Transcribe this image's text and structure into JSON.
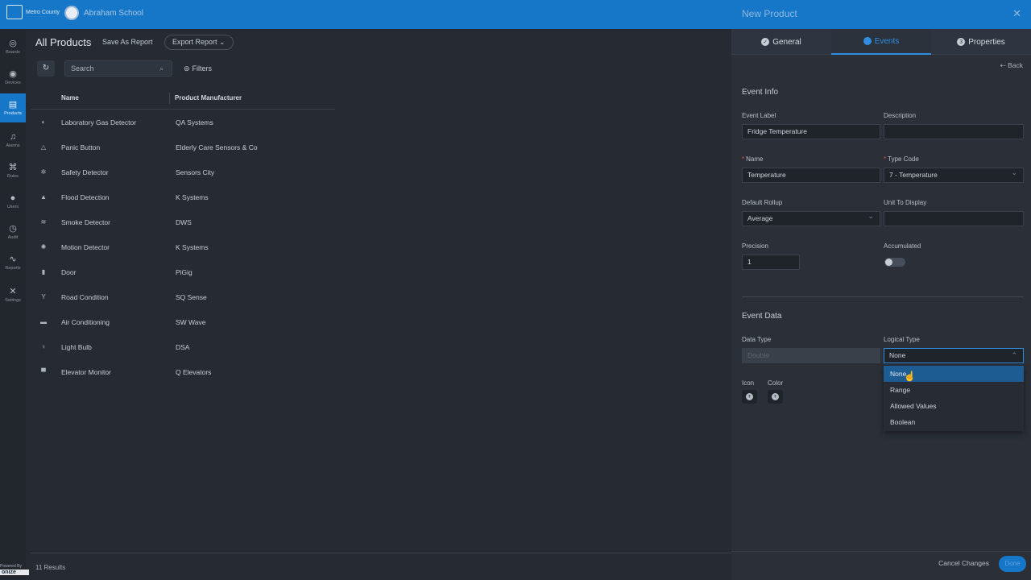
{
  "topbar": {
    "brand_label": "Metro County",
    "school_name": "Abraham School"
  },
  "sidebar": {
    "items": [
      {
        "label": "Boards",
        "icon": "dashboard-icon"
      },
      {
        "label": "Devices",
        "icon": "devices-icon"
      },
      {
        "label": "Products",
        "icon": "products-icon"
      },
      {
        "label": "Alarms",
        "icon": "bell-icon"
      },
      {
        "label": "Rules",
        "icon": "rules-icon"
      },
      {
        "label": "Users",
        "icon": "user-icon"
      },
      {
        "label": "Audit",
        "icon": "history-icon"
      },
      {
        "label": "Reports",
        "icon": "reports-icon"
      },
      {
        "label": "Settings",
        "icon": "tools-icon"
      }
    ],
    "active": "Products",
    "powered_by": "Powered By",
    "powered_brand": "onize"
  },
  "main": {
    "title": "All Products",
    "save_as_report": "Save As Report",
    "export_report": "Export Report",
    "search_placeholder": "Search",
    "filters": "Filters",
    "columns": {
      "name": "Name",
      "manufacturer": "Product Manufacturer"
    },
    "rows": [
      {
        "name": "Laboratory Gas Detector",
        "manufacturer": "QA Systems",
        "icon": "gas-detector-icon"
      },
      {
        "name": "Panic Button",
        "manufacturer": "Elderly Care Sensors & Co",
        "icon": "warning-icon"
      },
      {
        "name": "Safety Detector",
        "manufacturer": "Sensors City",
        "icon": "safety-detector-icon"
      },
      {
        "name": "Flood Detection",
        "manufacturer": "K Systems",
        "icon": "flood-icon"
      },
      {
        "name": "Smoke Detector",
        "manufacturer": "DWS",
        "icon": "smoke-icon"
      },
      {
        "name": "Motion Detector",
        "manufacturer": "K Systems",
        "icon": "motion-icon"
      },
      {
        "name": "Door",
        "manufacturer": "PiGig",
        "icon": "door-icon"
      },
      {
        "name": "Road Condition",
        "manufacturer": "SQ Sense",
        "icon": "road-icon"
      },
      {
        "name": "Air Conditioning",
        "manufacturer": "SW Wave",
        "icon": "air-conditioning-icon"
      },
      {
        "name": "Light Bulb",
        "manufacturer": "DSA",
        "icon": "light-bulb-icon"
      },
      {
        "name": "Elevator Monitor",
        "manufacturer": "Q Elevators",
        "icon": "elevator-icon"
      }
    ],
    "results": "11 Results"
  },
  "panel": {
    "title": "New Product",
    "tabs": [
      {
        "label": "General",
        "active": false
      },
      {
        "label": "Events",
        "active": true
      },
      {
        "label": "Properties",
        "active": false
      }
    ],
    "back": "Back",
    "event_info": {
      "title": "Event Info",
      "event_label": {
        "label": "Event Label",
        "value": "Fridge Temperature"
      },
      "description": {
        "label": "Description",
        "value": ""
      },
      "name": {
        "label": "Name",
        "value": "Temperature",
        "required": true
      },
      "type_code": {
        "label": "Type Code",
        "value": "7 - Temperature",
        "required": true
      },
      "default_rollup": {
        "label": "Default Rollup",
        "value": "Average"
      },
      "unit_to_display": {
        "label": "Unit To Display",
        "value": ""
      },
      "precision": {
        "label": "Precision",
        "value": "1"
      },
      "accumulated": {
        "label": "Accumulated",
        "on": false
      }
    },
    "event_data": {
      "title": "Event Data",
      "data_type": {
        "label": "Data Type",
        "value": "Double",
        "disabled": true
      },
      "logical_type": {
        "label": "Logical Type",
        "value": "None"
      },
      "icon_label": "Icon",
      "color_label": "Color",
      "options": [
        "None",
        "Range",
        "Allowed Values",
        "Boolean"
      ],
      "selected_option": "None"
    },
    "cancel": "Cancel Changes",
    "done": "Done"
  },
  "colors": {
    "accent": "#1677c9",
    "background": "#262b33",
    "panel": "#2b3038",
    "selected_option": "#1d5c93"
  }
}
